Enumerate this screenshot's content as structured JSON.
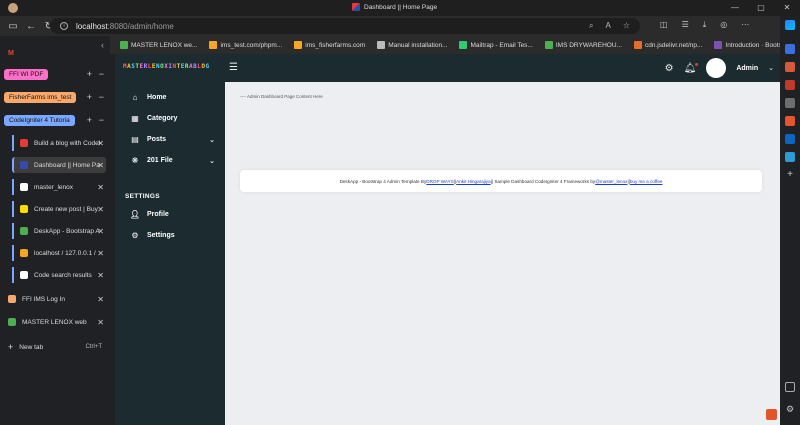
{
  "window": {
    "title": "Dashboard || Home Page",
    "controls": [
      "—",
      "▢",
      "✕"
    ]
  },
  "address_bar": {
    "url_host": "localhost",
    "url_path": ":8080/admin/home"
  },
  "bookmarks": [
    {
      "label": "MASTER LENOX we...",
      "color": "#4caf50"
    },
    {
      "label": "ims_test.com/phpm...",
      "color": "#f5a623"
    },
    {
      "label": "ims_fisherfarms.com",
      "color": "#f5a623"
    },
    {
      "label": "Manual installation...",
      "color": "#bbbbbb"
    },
    {
      "label": "Mailtrap - Email Tes...",
      "color": "#2ecc71"
    },
    {
      "label": "IMS DRYWAREHOU...",
      "color": "#4caf50"
    },
    {
      "label": "cdn.jsdelivr.net/np...",
      "color": "#e66b2e"
    },
    {
      "label": "Introduction · Boots...",
      "color": "#7952b3"
    }
  ],
  "vtabs": {
    "groups": [
      {
        "label": "FFI WI PDF",
        "color": "#ff6ec7"
      },
      {
        "label": "FisherFarms ims_test",
        "color": "#f9a86a"
      },
      {
        "label": "CodeIgniter 4 Tutoria",
        "color": "#7aa7ff"
      }
    ],
    "nested_tabs": [
      {
        "label": "Build a blog with Codel",
        "color": "#e53935"
      },
      {
        "label": "Dashboard || Home Page",
        "color": "#3949ab"
      },
      {
        "label": "master_lenox",
        "color": "#ffffff"
      },
      {
        "label": "Create new post | Buy",
        "color": "#ffdd00"
      },
      {
        "label": "DeskApp - Bootstrap A",
        "color": "#4caf50"
      },
      {
        "label": "localhost / 127.0.0.1 /",
        "color": "#f5a623"
      },
      {
        "label": "Code search results",
        "color": "#ffffff"
      }
    ],
    "tabs": [
      {
        "label": "FFI IMS Log In",
        "color": "#f9a86a"
      },
      {
        "label": "MASTER LENOX web port",
        "color": "#4caf50"
      }
    ],
    "new_tab": {
      "label": "New tab",
      "shortcut": "Ctrl+T"
    }
  },
  "app": {
    "logo": "MASTERLENOXINTERABLOG",
    "user_name": "Admin",
    "sidebar": {
      "items": [
        {
          "label": "Home",
          "icon": "home-icon"
        },
        {
          "label": "Category",
          "icon": "category-icon"
        },
        {
          "label": "Posts",
          "icon": "posts-icon"
        },
        {
          "label": "201 File",
          "icon": "file-icon"
        }
      ],
      "settings_heading": "SETTINGS",
      "settings_items": [
        {
          "label": "Profile",
          "icon": "user-icon"
        },
        {
          "label": "Settings",
          "icon": "gear-icon"
        }
      ]
    },
    "content": {
      "breadcrumb": "---- Admin Dashboard Page Content Here",
      "footer_prefix": "DeskApp - Bootstrap 4 Admin Template By ",
      "footer_link1": "DROP WAYS",
      "footer_mid1": " || ",
      "footer_link2": "Ankit Hingarajiya",
      "footer_mid2": " || Sample Dashboard CodeIgniter 4 Frameworks by ",
      "footer_link3": "@master_lenox",
      "footer_mid3": " || ",
      "footer_link4": "buy me a coffee"
    }
  }
}
